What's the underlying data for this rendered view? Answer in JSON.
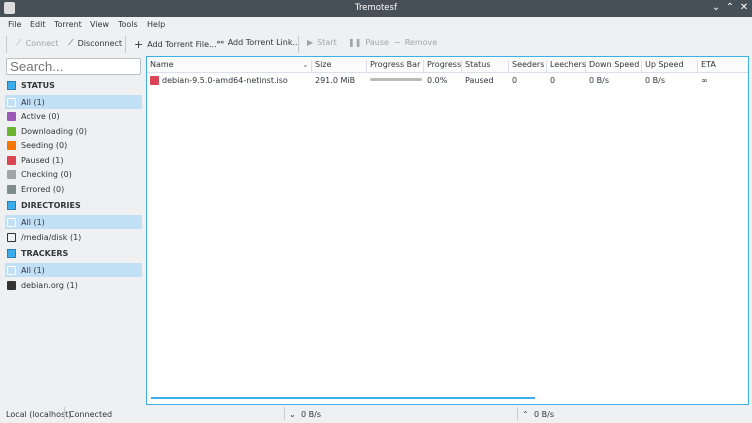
{
  "window": {
    "title": "Tremotesf"
  },
  "menu": [
    "File",
    "Edit",
    "Torrent",
    "View",
    "Tools",
    "Help"
  ],
  "toolbar": {
    "connect": "Connect",
    "disconnect": "Disconnect",
    "add_file": "Add Torrent File...",
    "add_link": "Add Torrent Link...",
    "start": "Start",
    "pause": "Pause",
    "remove": "Remove"
  },
  "search": {
    "placeholder": "Search..."
  },
  "sidebar": {
    "status_header": "STATUS",
    "status_items": [
      {
        "label": "All (1)",
        "color": "#ffffff"
      },
      {
        "label": "Active (0)",
        "color": "#9b59b6"
      },
      {
        "label": "Downloading (0)",
        "color": "#6ab42d"
      },
      {
        "label": "Seeding (0)",
        "color": "#f67400"
      },
      {
        "label": "Paused (1)",
        "color": "#da4453"
      },
      {
        "label": "Checking (0)",
        "color": "#a0a4a8"
      },
      {
        "label": "Errored (0)",
        "color": "#7f8c8d"
      }
    ],
    "directories_header": "DIRECTORIES",
    "directory_items": [
      {
        "label": "All (1)"
      },
      {
        "label": "/media/disk (1)"
      }
    ],
    "trackers_header": "TRACKERS",
    "tracker_items": [
      {
        "label": "All (1)"
      },
      {
        "label": "debian.org (1)"
      }
    ]
  },
  "table": {
    "columns": [
      "Name",
      "Size",
      "Progress Bar",
      "Progress",
      "Status",
      "Seeders",
      "Leechers",
      "Down Speed",
      "Up Speed",
      "ETA"
    ],
    "rows": [
      {
        "name": "debian-9.5.0-amd64-netinst.iso",
        "size": "291.0 MiB",
        "progress_fraction": 0.0,
        "progress": "0.0%",
        "status": "Paused",
        "seeders": "0",
        "leechers": "0",
        "down": "0 B/s",
        "up": "0 B/s",
        "eta": "∞"
      }
    ]
  },
  "statusbar": {
    "server": "Local (localhost)",
    "state": "Connected",
    "down": "0 B/s",
    "up": "0 B/s"
  }
}
